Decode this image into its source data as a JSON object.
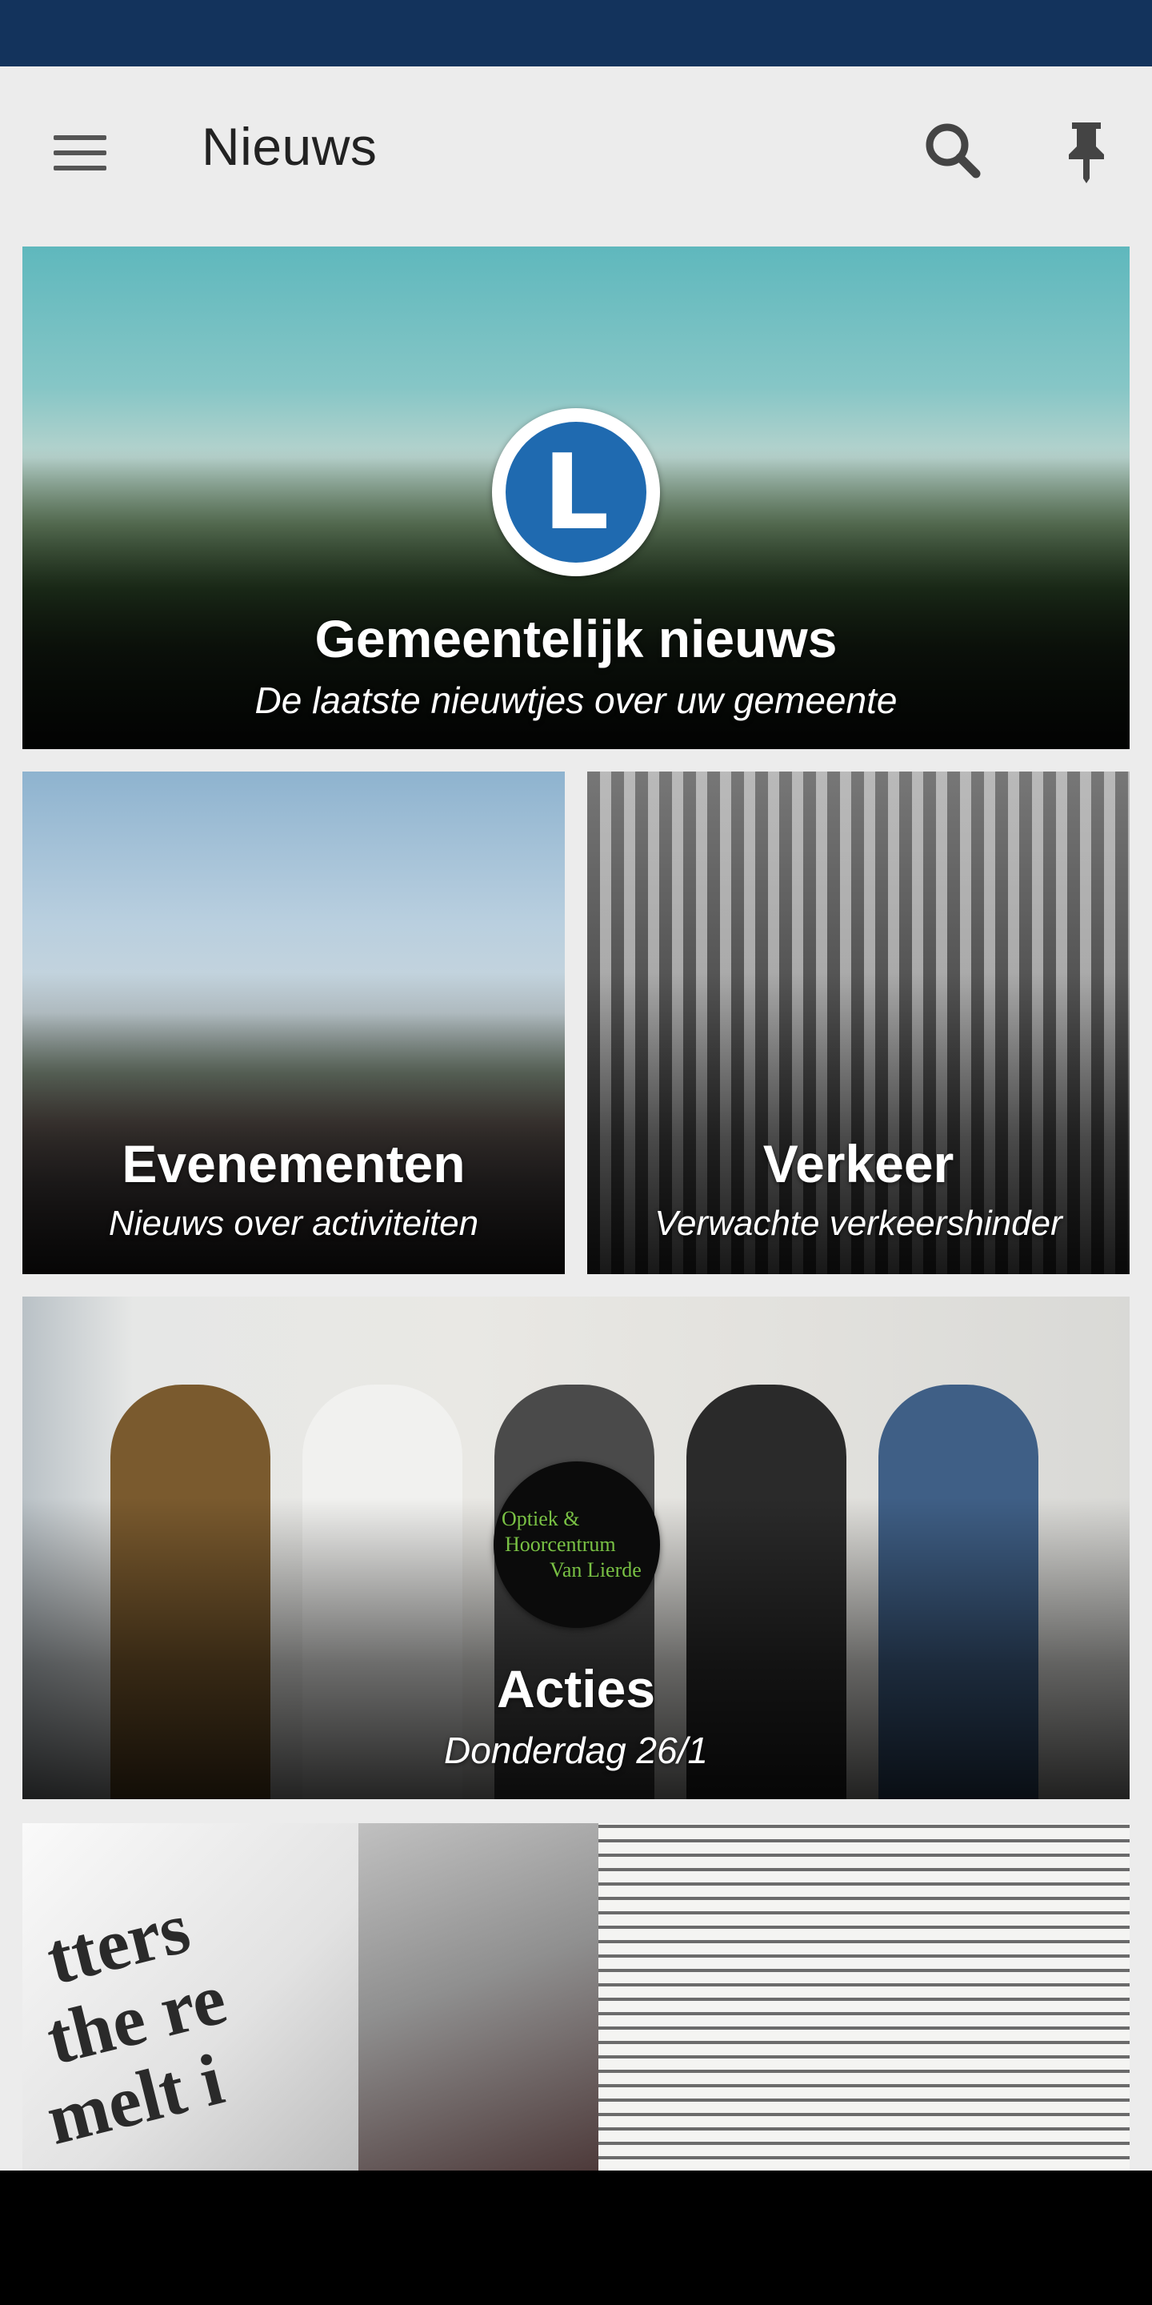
{
  "app_bar": {
    "title": "Nieuws",
    "menu_icon": "hamburger-menu-icon",
    "search_icon": "search-icon",
    "pin_icon": "pushpin-icon"
  },
  "colors": {
    "status_bar": "#13335c",
    "background": "#ececec",
    "logo_blue": "#1f6ab0",
    "logo_green": "#79c144"
  },
  "cards": [
    {
      "title": "Gemeentelijk nieuws",
      "subtitle": "De laatste nieuwtjes over uw gemeente",
      "logo_letter": "L"
    },
    {
      "title": "Evenementen",
      "subtitle": "Nieuws over activiteiten"
    },
    {
      "title": "Verkeer",
      "subtitle": "Verwachte verkeershinder"
    },
    {
      "title": "Acties",
      "subtitle": "Donderdag 26/1",
      "logo_lines": [
        "Optiek &",
        "Hoorcentrum",
        "Van Lierde"
      ]
    },
    {
      "title": "",
      "subtitle": "",
      "newsprint_words": [
        "tters",
        "the re",
        "melt i"
      ]
    }
  ]
}
